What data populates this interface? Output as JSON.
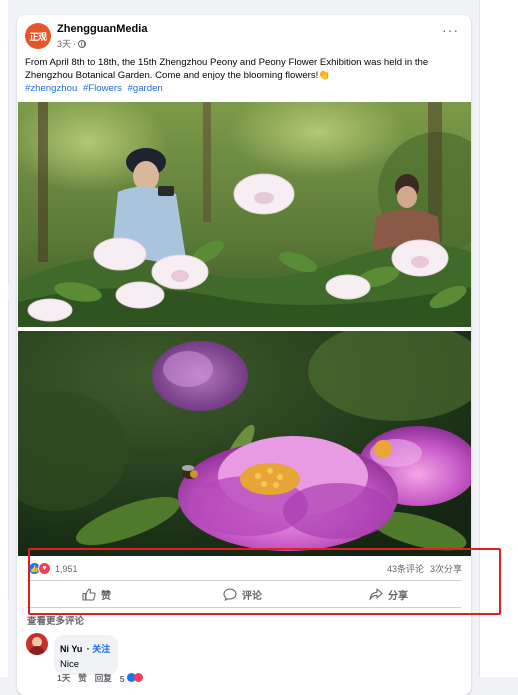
{
  "post": {
    "author": "ZhengguanMedia",
    "avatar_text": "正观",
    "time": "3天",
    "separator": "·",
    "more_icon": "more-horizontal-icon",
    "text": "From April 8th to 18th, the 15th Zhengzhou Peony and Peony Flower Exhibition was held in the Zhengzhou Botanical Garden. Come and enjoy the blooming flowers!👏",
    "hashtags": [
      "#zhengzhou",
      "#Flowers",
      "#garden"
    ]
  },
  "stats": {
    "reactions_count": "1,951",
    "comments_label": "43条评论",
    "shares_label": "3次分享"
  },
  "actions": {
    "like_label": "赞",
    "comment_label": "评论",
    "share_label": "分享"
  },
  "comments": {
    "more_label": "查看更多评论",
    "items": [
      {
        "name": "Ni Yu",
        "follow_label": "关注",
        "text": "Nice",
        "time": "1天",
        "like_label": "赞",
        "reply_label": "回复",
        "reaction_count": "5"
      }
    ]
  },
  "colors": {
    "link_blue": "#216fdb",
    "like_blue": "#1877f2",
    "love_red": "#f33e58",
    "highlight_red": "#e02020",
    "brand_orange": "#e8552a"
  }
}
